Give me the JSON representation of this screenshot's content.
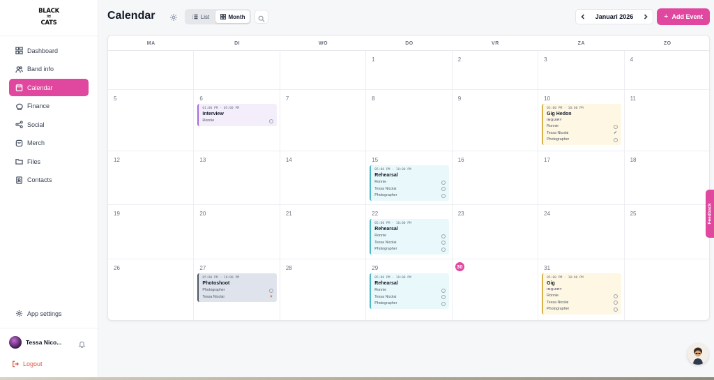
{
  "app": {
    "logo_line1": "BLACK",
    "logo_line2": "CATS"
  },
  "sidebar": {
    "items": [
      {
        "label": "Dashboard",
        "icon": "dashboard-icon"
      },
      {
        "label": "Band info",
        "icon": "users-icon"
      },
      {
        "label": "Calendar",
        "icon": "calendar-icon",
        "active": true
      },
      {
        "label": "Finance",
        "icon": "piggy-bank-icon"
      },
      {
        "label": "Social",
        "icon": "share-icon"
      },
      {
        "label": "Merch",
        "icon": "shirt-icon"
      },
      {
        "label": "Files",
        "icon": "folder-icon"
      },
      {
        "label": "Contacts",
        "icon": "contacts-icon"
      }
    ],
    "app_settings": "App settings",
    "user_name": "Tessa Nico...",
    "logout": "Logout"
  },
  "header": {
    "title": "Calendar",
    "view_list": "List",
    "view_month": "Month",
    "month_label": "Januari 2026",
    "add_event": "Add Event"
  },
  "calendar": {
    "weekdays": [
      "MA",
      "DI",
      "WO",
      "DO",
      "VR",
      "ZA",
      "ZO"
    ],
    "weeks": [
      [
        "",
        "",
        "",
        "1",
        "2",
        "3",
        "4"
      ],
      [
        "5",
        "6",
        "7",
        "8",
        "9",
        "10",
        "11"
      ],
      [
        "12",
        "13",
        "14",
        "15",
        "16",
        "17",
        "18"
      ],
      [
        "19",
        "20",
        "21",
        "22",
        "23",
        "24",
        "25"
      ],
      [
        "26",
        "27",
        "28",
        "29",
        "30",
        "31",
        ""
      ]
    ],
    "today": "30",
    "events": [
      {
        "week": 1,
        "day": 1,
        "color": "purple",
        "time": "01:00 PM - 05:00 PM",
        "title": "Interview",
        "badge": "",
        "people": [
          {
            "name": "Ronnie",
            "status": "pending"
          }
        ]
      },
      {
        "week": 1,
        "day": 5,
        "color": "yellow",
        "time": "05:00 PM - 10:00 PM",
        "title": "Gig Hedon",
        "badge": "INQUIRY",
        "people": [
          {
            "name": "Ronnie",
            "status": "pending"
          },
          {
            "name": "Tessa Nicolai",
            "status": "accepted"
          },
          {
            "name": "Photographer",
            "status": "pending"
          }
        ]
      },
      {
        "week": 2,
        "day": 3,
        "color": "cyan",
        "time": "05:00 PM - 10:00 PM",
        "title": "Rehearsal",
        "badge": "",
        "people": [
          {
            "name": "Ronnie",
            "status": "pending"
          },
          {
            "name": "Tessa Nicolai",
            "status": "pending"
          },
          {
            "name": "Photographer",
            "status": "pending"
          }
        ]
      },
      {
        "week": 3,
        "day": 3,
        "color": "cyan",
        "time": "05:00 PM - 10:00 PM",
        "title": "Rehearsal",
        "badge": "",
        "people": [
          {
            "name": "Ronnie",
            "status": "pending"
          },
          {
            "name": "Tessa Nicolai",
            "status": "pending"
          },
          {
            "name": "Photographer",
            "status": "pending"
          }
        ]
      },
      {
        "week": 4,
        "day": 1,
        "color": "slate",
        "time": "05:00 PM - 10:00 PM",
        "title": "Photoshoot",
        "badge": "",
        "people": [
          {
            "name": "Photographer",
            "status": "pending"
          },
          {
            "name": "Tessa Nicolai",
            "status": "declined"
          }
        ]
      },
      {
        "week": 4,
        "day": 3,
        "color": "cyan",
        "time": "05:00 PM - 10:00 PM",
        "title": "Rehearsal",
        "badge": "",
        "people": [
          {
            "name": "Ronnie",
            "status": "pending"
          },
          {
            "name": "Tessa Nicolai",
            "status": "pending"
          },
          {
            "name": "Photographer",
            "status": "pending"
          }
        ]
      },
      {
        "week": 4,
        "day": 5,
        "color": "yellow",
        "time": "05:00 PM - 10:00 PM",
        "title": "Gig",
        "badge": "INQUIRY",
        "people": [
          {
            "name": "Ronnie",
            "status": "pending"
          },
          {
            "name": "Tessa Nicolai",
            "status": "pending"
          },
          {
            "name": "Photographer",
            "status": "pending"
          }
        ]
      }
    ]
  },
  "feedback": "Feedback",
  "colors": {
    "accent": "#e0479e",
    "logout": "#e0533e"
  }
}
